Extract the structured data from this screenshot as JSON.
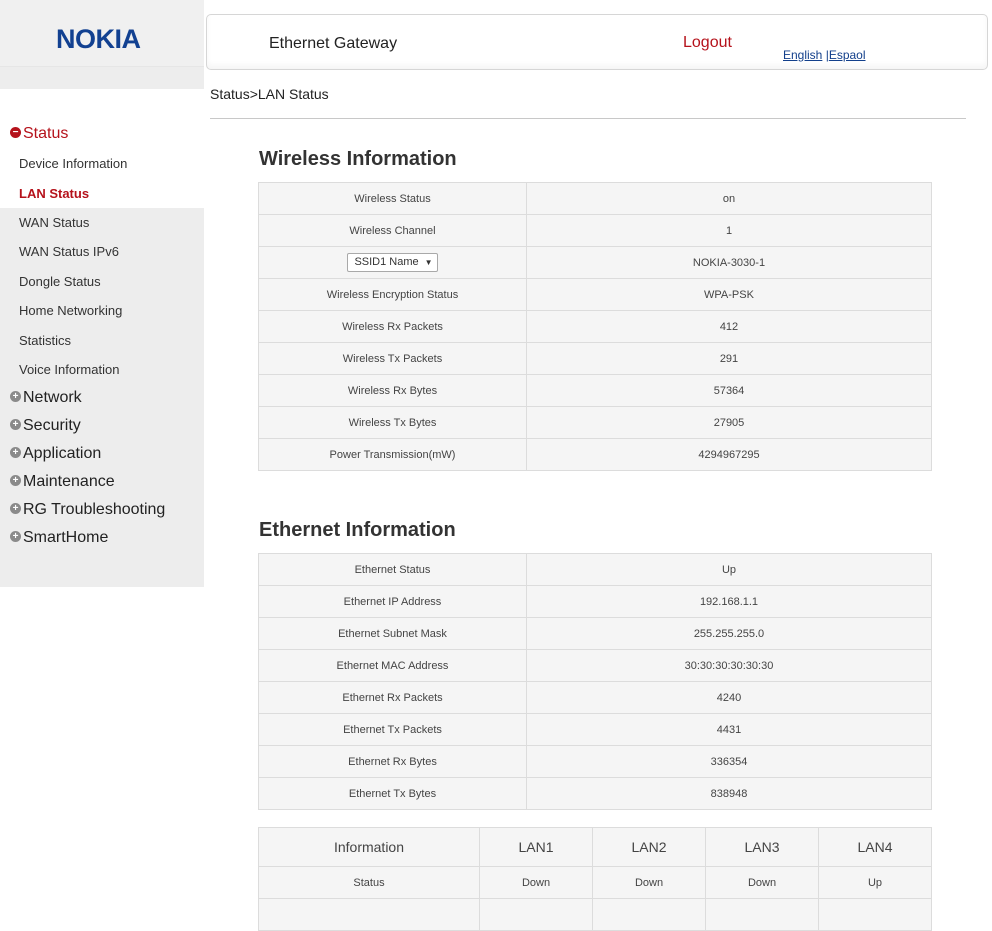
{
  "brand": {
    "logo": "NOKIA"
  },
  "header": {
    "title": "Ethernet Gateway",
    "logout": "Logout",
    "lang_english": "English",
    "lang_sep": " |",
    "lang_espanol": "Espaol"
  },
  "breadcrumb": "Status>LAN Status",
  "sidebar": {
    "status": "Status",
    "status_items": [
      "Device Information",
      "LAN Status",
      "WAN Status",
      "WAN Status IPv6",
      "Dongle Status",
      "Home Networking",
      "Statistics",
      "Voice Information"
    ],
    "sections": [
      "Network",
      "Security",
      "Application",
      "Maintenance",
      "RG Troubleshooting",
      "SmartHome"
    ]
  },
  "wireless": {
    "title": "Wireless Information",
    "rows": [
      {
        "label": "Wireless Status",
        "value": "on"
      },
      {
        "label": "Wireless Channel",
        "value": "1"
      },
      {
        "label": "SSID1 Name",
        "value": "NOKIA-3030-1"
      },
      {
        "label": "Wireless Encryption Status",
        "value": "WPA-PSK"
      },
      {
        "label": "Wireless Rx Packets",
        "value": "412"
      },
      {
        "label": "Wireless Tx Packets",
        "value": "291"
      },
      {
        "label": "Wireless Rx Bytes",
        "value": "57364"
      },
      {
        "label": "Wireless Tx Bytes",
        "value": "27905"
      },
      {
        "label": "Power Transmission(mW)",
        "value": "4294967295"
      }
    ]
  },
  "ethernet": {
    "title": "Ethernet Information",
    "rows": [
      {
        "label": "Ethernet Status",
        "value": "Up"
      },
      {
        "label": "Ethernet IP Address",
        "value": "192.168.1.1"
      },
      {
        "label": "Ethernet Subnet Mask",
        "value": "255.255.255.0"
      },
      {
        "label": "Ethernet MAC Address",
        "value": "30:30:30:30:30:30"
      },
      {
        "label": "Ethernet Rx Packets",
        "value": "4240"
      },
      {
        "label": "Ethernet Tx Packets",
        "value": "4431"
      },
      {
        "label": "Ethernet Rx Bytes",
        "value": "336354"
      },
      {
        "label": "Ethernet Tx Bytes",
        "value": "838948"
      }
    ]
  },
  "lan_table": {
    "headers": [
      "Information",
      "LAN1",
      "LAN2",
      "LAN3",
      "LAN4"
    ],
    "rows": [
      [
        "Status",
        "Down",
        "Down",
        "Down",
        "Up"
      ]
    ]
  },
  "colors": {
    "brand_blue": "#124191",
    "accent_red": "#b5121b"
  }
}
